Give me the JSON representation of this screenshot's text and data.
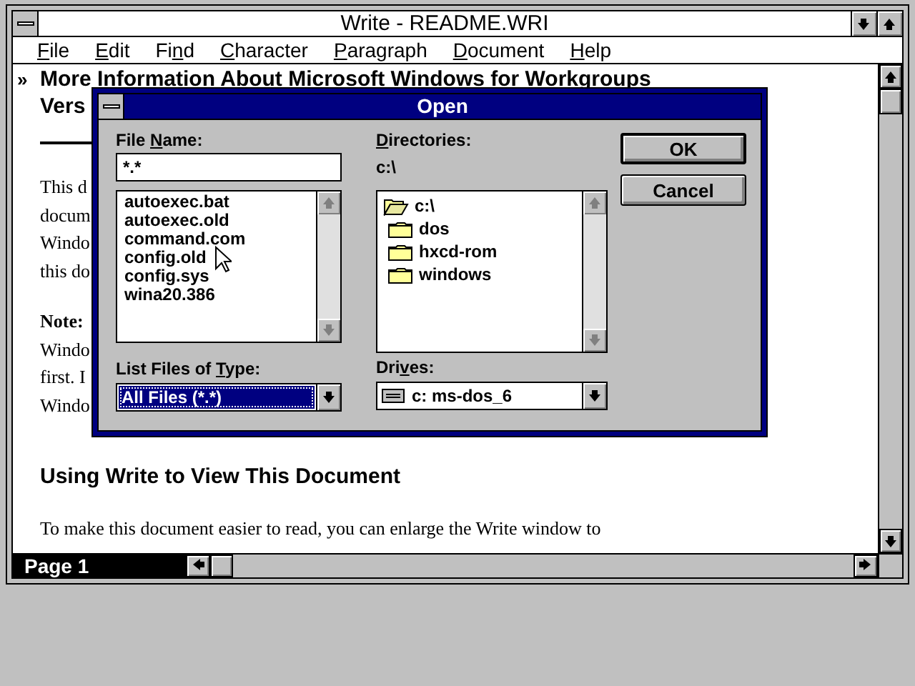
{
  "window": {
    "title": "Write - README.WRI"
  },
  "menu": [
    {
      "key": "F",
      "post": "ile"
    },
    {
      "key": "E",
      "post": "dit"
    },
    {
      "pre": "Fi",
      "key": "n",
      "post": "d"
    },
    {
      "key": "C",
      "post": "haracter"
    },
    {
      "key": "P",
      "post": "aragraph"
    },
    {
      "key": "D",
      "post": "ocument"
    },
    {
      "key": "H",
      "post": "elp"
    }
  ],
  "document": {
    "blocks": [
      {
        "kind": "heading",
        "marker": "»",
        "lines": [
          "More Information About Microsoft Windows for Workgroups",
          "Vers"
        ]
      },
      {
        "kind": "rule"
      },
      {
        "kind": "paragraph",
        "lines": [
          "This d",
          "docum",
          "Windo",
          "this do"
        ]
      },
      {
        "kind": "note",
        "label": "Note:",
        "lines": [
          "Windo",
          "first. I",
          "Windo"
        ]
      },
      {
        "kind": "heading",
        "lines": [
          "Using Write to View This Document"
        ]
      },
      {
        "kind": "paragraph",
        "lines": [
          "To make this document easier to read, you can enlarge the Write window to"
        ]
      }
    ]
  },
  "status_bar": {
    "page": "Page 1"
  },
  "dialog": {
    "title": "Open",
    "file_name": {
      "label": {
        "pre": "File ",
        "key": "N",
        "post": "ame:"
      },
      "value": "*.*"
    },
    "files": [
      {
        "name": "autoexec.bat",
        "selected": false
      },
      {
        "name": "autoexec.old",
        "selected": false
      },
      {
        "name": "command.com",
        "selected": false
      },
      {
        "name": "config.old",
        "selected": false
      },
      {
        "name": "config.sys",
        "selected": false
      },
      {
        "name": "wina20.386",
        "selected": false
      }
    ],
    "file_type": {
      "label": {
        "pre": "List Files of ",
        "key": "T",
        "post": "ype:"
      },
      "value": "All Files (*.*)",
      "focused": true
    },
    "directories": {
      "label": {
        "key": "D",
        "post": "irectories:"
      },
      "path": "c:\\",
      "tree": [
        {
          "name": "c:\\",
          "expanded": true,
          "children": [
            {
              "name": "dos",
              "expanded": false
            },
            {
              "name": "hxcd-rom",
              "expanded": false
            },
            {
              "name": "windows",
              "expanded": false
            }
          ]
        }
      ]
    },
    "drives": {
      "label": {
        "pre": "Dri",
        "key": "v",
        "post": "es:"
      },
      "value": "c: ms-dos_6"
    },
    "buttons": [
      {
        "label": "OK",
        "default": true
      },
      {
        "label": "Cancel",
        "default": false
      }
    ]
  }
}
